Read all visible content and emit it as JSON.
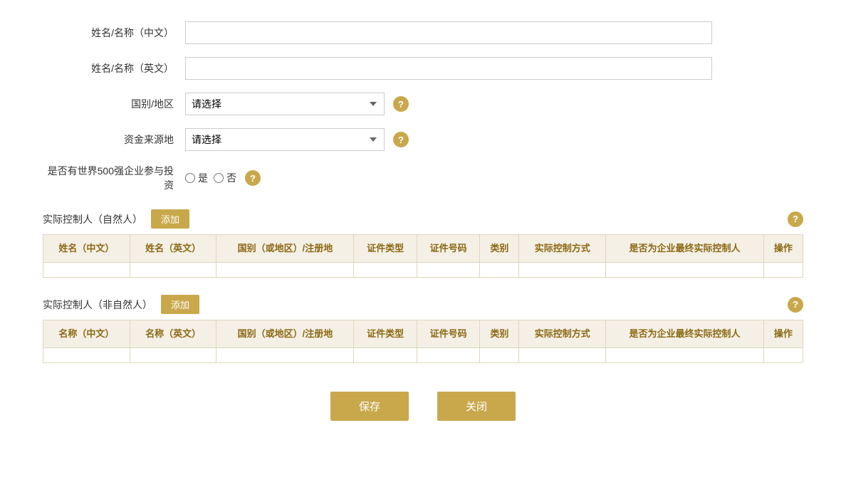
{
  "form": {
    "name_cn_label": "姓名/名称（中文）",
    "name_en_label": "姓名/名称（英文）",
    "country_label": "国别/地区",
    "fund_source_label": "资金来源地",
    "fortune500_label": "是否有世界500强企业参与投资",
    "country_placeholder": "请选择",
    "fund_source_placeholder": "请选择",
    "yes_label": "是",
    "no_label": "否"
  },
  "section1": {
    "title": "实际控制人（自然人）",
    "add_label": "添加",
    "columns": [
      "姓名（中文）",
      "姓名（英文）",
      "国别（或地区）/注册地",
      "证件类型",
      "证件号码",
      "类别",
      "实际控制方式",
      "是否为企业最终实际控制人",
      "操作"
    ]
  },
  "section2": {
    "title": "实际控制人（非自然人）",
    "add_label": "添加",
    "columns": [
      "名称（中文）",
      "名称（英文）",
      "国别（或地区）/注册地",
      "证件类型",
      "证件号码",
      "类别",
      "实际控制方式",
      "是否为企业最终实际控制人",
      "操作"
    ]
  },
  "footer": {
    "save_label": "保存",
    "close_label": "关闭"
  },
  "help_icon": "?",
  "icons": {
    "chevron": "▾"
  }
}
